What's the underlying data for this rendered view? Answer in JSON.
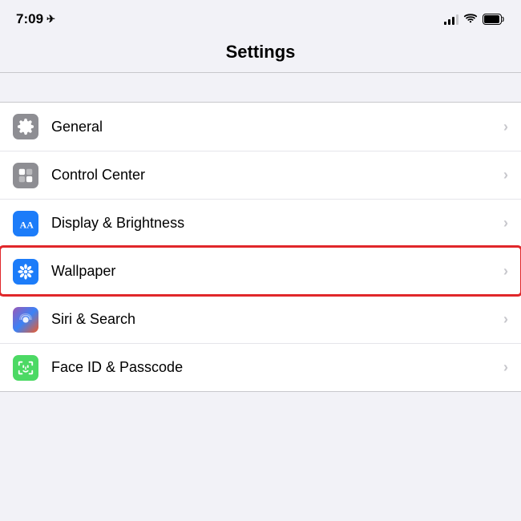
{
  "statusBar": {
    "time": "7:09",
    "locationIcon": "↗"
  },
  "header": {
    "title": "Settings"
  },
  "settingsItems": [
    {
      "id": "general",
      "label": "General",
      "iconBg": "#8e8e93",
      "iconType": "gear"
    },
    {
      "id": "control-center",
      "label": "Control Center",
      "iconBg": "#8e8e93",
      "iconType": "toggle"
    },
    {
      "id": "display-brightness",
      "label": "Display & Brightness",
      "iconBg": "#1c7cf9",
      "iconType": "display"
    },
    {
      "id": "wallpaper",
      "label": "Wallpaper",
      "iconBg": "#1c7cf9",
      "iconType": "wallpaper",
      "highlighted": true
    },
    {
      "id": "siri-search",
      "label": "Siri & Search",
      "iconBg": "siri",
      "iconType": "siri"
    },
    {
      "id": "face-id",
      "label": "Face ID & Passcode",
      "iconBg": "#34c759",
      "iconType": "faceid"
    }
  ],
  "chevron": "›"
}
